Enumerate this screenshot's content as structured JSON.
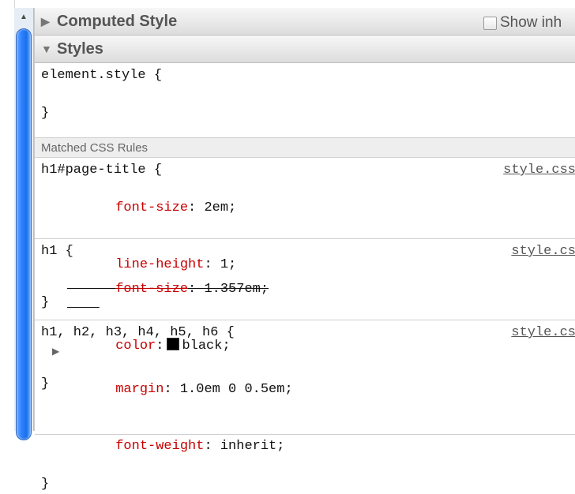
{
  "computed_style": {
    "title": "Computed Style",
    "show_inherited": "Show inh"
  },
  "styles": {
    "title": "Styles",
    "element_style": {
      "open": "element.style {",
      "close": "}"
    },
    "matched_rules_title": "Matched CSS Rules",
    "rules": [
      {
        "selector": "h1#page-title {",
        "source": "style.css",
        "decls": [
          {
            "prop": "font-size",
            "value": "2em;"
          },
          {
            "prop": "line-height",
            "value": "1;"
          }
        ],
        "close": "}"
      },
      {
        "selector": "h1 {",
        "source": "style.cs",
        "decls": [
          {
            "prop": "font-size",
            "value": "1.357em;"
          },
          {
            "prop": "color",
            "value": "black;"
          }
        ],
        "close": "}"
      },
      {
        "selector": "h1, h2, h3, h4, h5, h6 {",
        "source": "style.cs",
        "decls": [
          {
            "prop": "margin",
            "value": "1.0em 0 0.5em;"
          },
          {
            "prop": "font-weight",
            "value": "inherit;"
          }
        ],
        "close": "}"
      }
    ]
  }
}
